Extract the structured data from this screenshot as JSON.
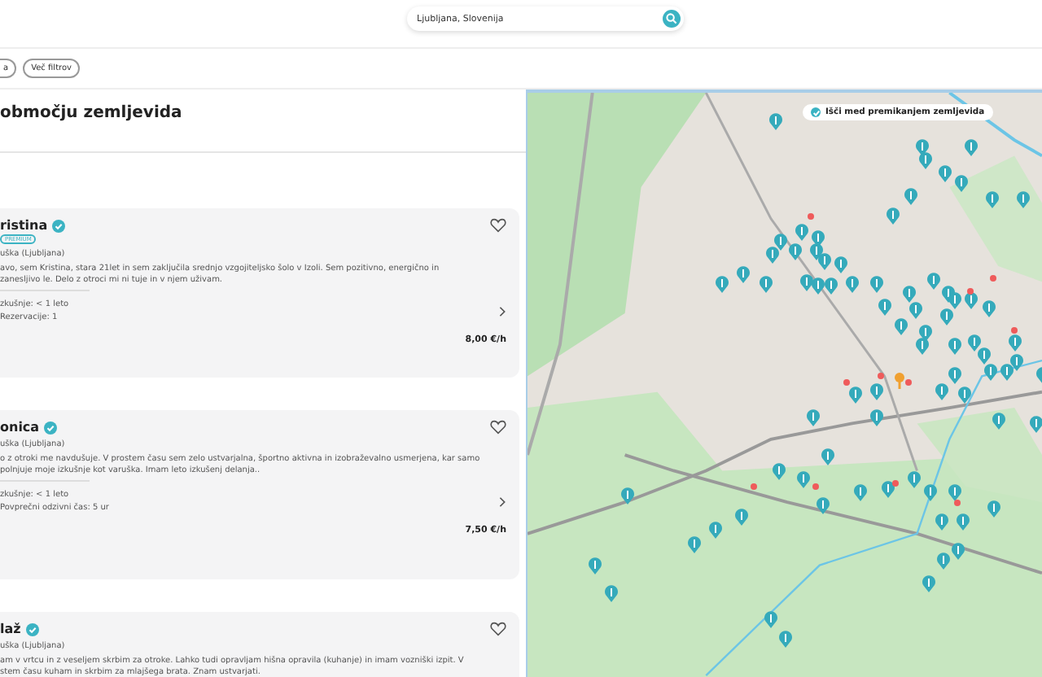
{
  "search": {
    "value": "Ljubljana, Slovenija"
  },
  "filters": [
    {
      "label": "a"
    },
    {
      "label": "Več filtrov"
    }
  ],
  "heading": "območju zemljevida",
  "cards": [
    {
      "name": "ristina",
      "verified": true,
      "badge": "PREMIUM",
      "role": "uška (Ljubljana)",
      "description": "avo, sem Kristina, stara 21let in sem zaključila srednjo vzgojiteljsko šolo v Izoli. Sem pozitivno, energično in zanesljivo le. Delo z otroci mi ni tuje in v njem uživam.",
      "stats": [
        "zkušnje: < 1 leto",
        "Rezervacije: 1"
      ],
      "price": "8,00 €/h",
      "favorite": false
    },
    {
      "name": "onica",
      "verified": true,
      "role": "uška (Ljubljana)",
      "description": "o z otroki me navdušuje. V prostem času sem zelo ustvarjalna, športno aktivna in izobraževalno usmerjena, kar samo polnjuje moje izkušnje kot varuška. Imam leto izkušenj delanja..",
      "stats": [
        "zkušnje: < 1 leto",
        "Povprečni odzivni čas: 5 ur"
      ],
      "price": "7,50 €/h",
      "favorite": false
    },
    {
      "name": "laž",
      "verified": true,
      "role": "uška (Ljubljana)",
      "description": "am v vrtcu in z veseljem skrbim za otroke. Lahko tudi opravljam hišna opravila (kuhanje) in imam vozniški izpit. V stem času kuham in skrbim za mlajšega brata. Znam ustvarjati.",
      "favorite": false
    }
  ],
  "map": {
    "search_on_move": {
      "label": "Išči med premikanjem zemljevida",
      "checked": true
    }
  }
}
